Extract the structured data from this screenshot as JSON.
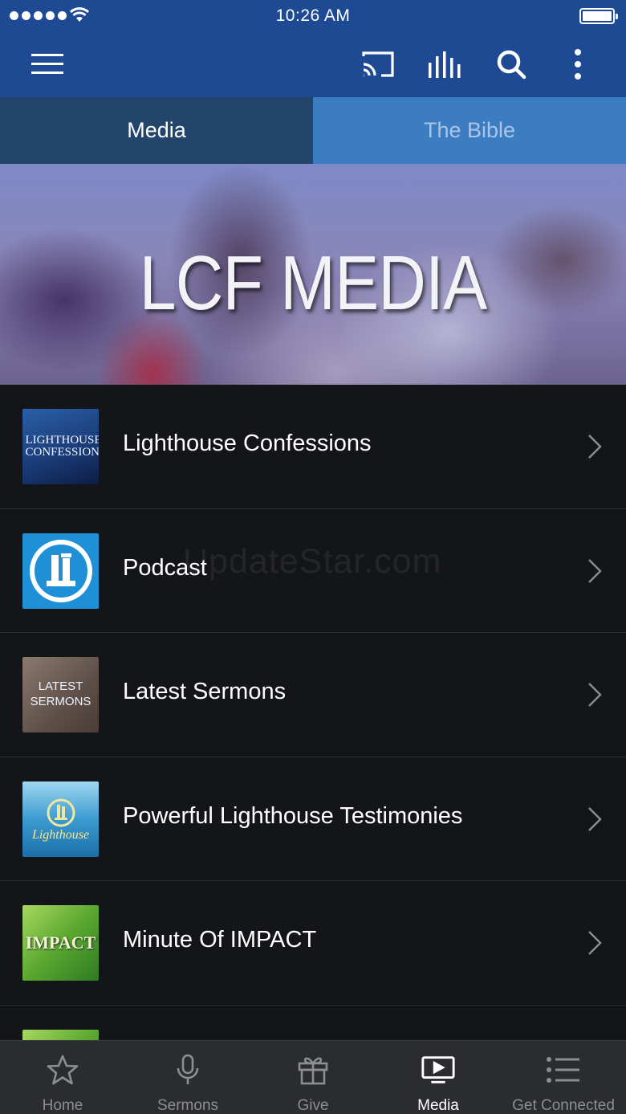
{
  "status_bar": {
    "time": "10:26 AM"
  },
  "tabs": [
    {
      "label": "Media",
      "active": true
    },
    {
      "label": "The Bible",
      "active": false
    }
  ],
  "banner": {
    "title": "LCF MEDIA"
  },
  "list": [
    {
      "label": "Lighthouse Confessions",
      "thumb_text": "LIGHTHOUSE CONFESSIONS"
    },
    {
      "label": "Podcast",
      "thumb_text": "L"
    },
    {
      "label": "Latest Sermons",
      "thumb_text": "LATEST SERMONS"
    },
    {
      "label": "Powerful Lighthouse Testimonies",
      "thumb_text": "Lighthouse"
    },
    {
      "label": "Minute Of IMPACT",
      "thumb_text": "IMPACT"
    }
  ],
  "watermark": "UpdateStar.com",
  "bottom_nav": [
    {
      "label": "Home",
      "icon": "star-icon",
      "active": false
    },
    {
      "label": "Sermons",
      "icon": "microphone-icon",
      "active": false
    },
    {
      "label": "Give",
      "icon": "gift-icon",
      "active": false
    },
    {
      "label": "Media",
      "icon": "media-play-icon",
      "active": true
    },
    {
      "label": "Get Connected",
      "icon": "list-icon",
      "active": false
    }
  ],
  "colors": {
    "header": "#1d4a93",
    "tab_active": "#23456c",
    "tab_inactive": "#3c7cc1",
    "list_bg": "#141518",
    "nav_bg": "#2b2c30"
  }
}
